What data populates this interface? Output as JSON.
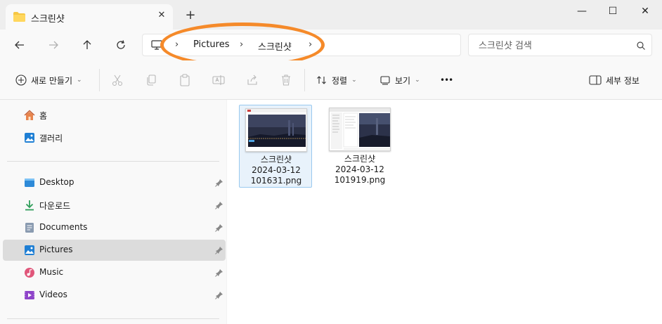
{
  "tab": {
    "title": "스크린샷",
    "close": "✕",
    "new_tab": "+"
  },
  "window_controls": {
    "minimize": "—",
    "maximize": "☐",
    "close": "✕"
  },
  "address": {
    "breadcrumbs": [
      "Pictures",
      "스크린샷"
    ],
    "separator": "›"
  },
  "search": {
    "placeholder": "스크린샷 검색"
  },
  "toolbar": {
    "new_label": "새로 만들기",
    "sort_label": "정렬",
    "view_label": "보기",
    "more_label": "•••",
    "details_label": "세부 정보",
    "chevron": "⌄"
  },
  "sidebar": {
    "top_items": [
      {
        "label": "홈",
        "icon": "home-icon"
      },
      {
        "label": "갤러리",
        "icon": "gallery-icon"
      }
    ],
    "quick_access": [
      {
        "label": "Desktop",
        "icon": "desktop-icon",
        "pinned": true
      },
      {
        "label": "다운로드",
        "icon": "download-icon",
        "pinned": true
      },
      {
        "label": "Documents",
        "icon": "documents-icon",
        "pinned": true
      },
      {
        "label": "Pictures",
        "icon": "pictures-icon",
        "pinned": true,
        "selected": true
      },
      {
        "label": "Music",
        "icon": "music-icon",
        "pinned": true
      },
      {
        "label": "Videos",
        "icon": "videos-icon",
        "pinned": true
      }
    ]
  },
  "files": [
    {
      "line1": "스크린샷",
      "line2": "2024-03-12",
      "line3": "101631.png",
      "selected": true
    },
    {
      "line1": "스크린샷",
      "line2": "2024-03-12",
      "line3": "101919.png",
      "selected": false
    }
  ],
  "colors": {
    "highlight": "#f58a2a",
    "selected_bg": "#e8f2fb",
    "accent": "#0067c0"
  }
}
